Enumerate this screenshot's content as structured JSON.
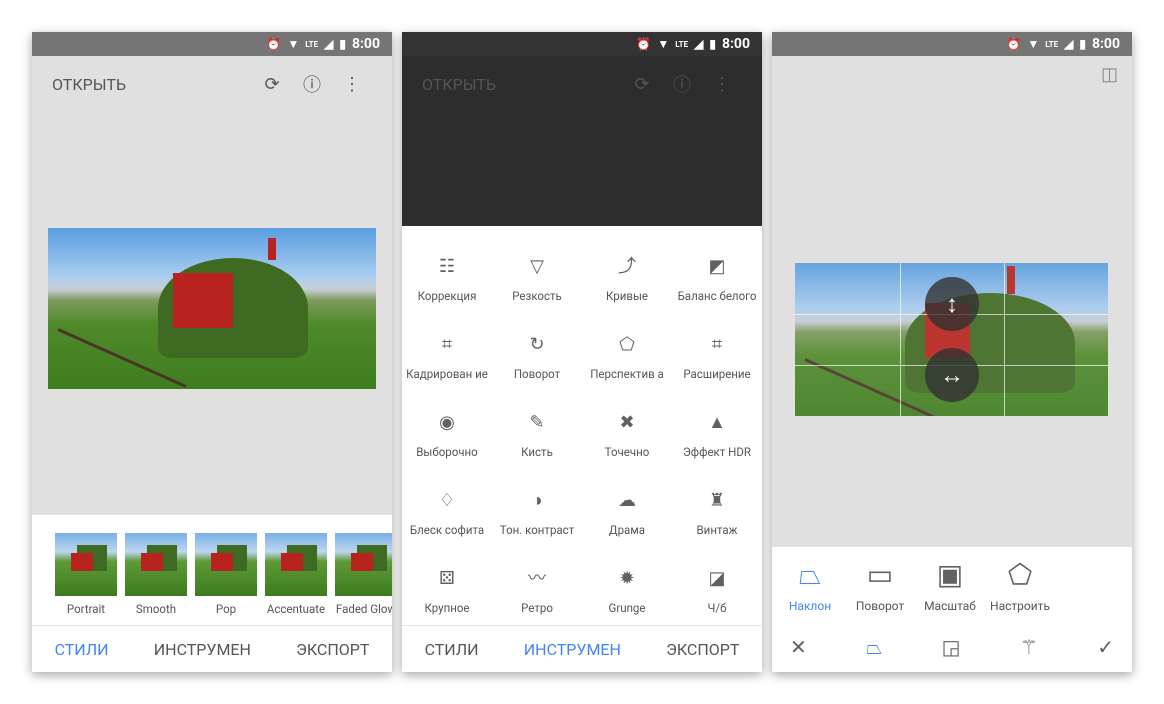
{
  "status": {
    "time": "8:00",
    "network": "LTE"
  },
  "panel1": {
    "header": {
      "open_label": "ОТКРЫТЬ"
    },
    "styles": [
      {
        "label": "Portrait"
      },
      {
        "label": "Smooth"
      },
      {
        "label": "Pop"
      },
      {
        "label": "Accentuate"
      },
      {
        "label": "Faded Glow"
      }
    ],
    "nav": {
      "styles": "СТИЛИ",
      "tools": "ИНСТРУМЕН",
      "export": "ЭКСПОРТ",
      "active": "styles"
    }
  },
  "panel2": {
    "header": {
      "open_label": "ОТКРЫТЬ"
    },
    "tools": [
      {
        "label": "Коррекция",
        "icon": "tune-icon",
        "glyph": "☷"
      },
      {
        "label": "Резкость",
        "icon": "triangle-icon",
        "glyph": "▽"
      },
      {
        "label": "Кривые",
        "icon": "curves-icon",
        "glyph": "⤴"
      },
      {
        "label": "Баланс белого",
        "icon": "white-balance-icon",
        "glyph": "◩"
      },
      {
        "label": "Кадрирован ие",
        "icon": "crop-icon",
        "glyph": "⌗"
      },
      {
        "label": "Поворот",
        "icon": "rotate-icon",
        "glyph": "↻"
      },
      {
        "label": "Перспектив а",
        "icon": "perspective-icon",
        "glyph": "⬠"
      },
      {
        "label": "Расширение",
        "icon": "expand-icon",
        "glyph": "⌗"
      },
      {
        "label": "Выборочно",
        "icon": "selective-icon",
        "glyph": "◉"
      },
      {
        "label": "Кисть",
        "icon": "brush-icon",
        "glyph": "✎"
      },
      {
        "label": "Точечно",
        "icon": "healing-icon",
        "glyph": "✖"
      },
      {
        "label": "Эффект HDR",
        "icon": "mountains-icon",
        "glyph": "▲"
      },
      {
        "label": "Блеск софита",
        "icon": "glamour-glow-icon",
        "glyph": "♢"
      },
      {
        "label": "Тон. контраст",
        "icon": "tonal-contrast-icon",
        "glyph": "◑"
      },
      {
        "label": "Драма",
        "icon": "cloud-icon",
        "glyph": "☁"
      },
      {
        "label": "Винтаж",
        "icon": "lamp-icon",
        "glyph": "♜"
      },
      {
        "label": "Крупное",
        "icon": "grain-icon",
        "glyph": "⚄"
      },
      {
        "label": "Ретро",
        "icon": "mustache-icon",
        "glyph": "〰"
      },
      {
        "label": "Grunge",
        "icon": "grunge-icon",
        "glyph": "✹"
      },
      {
        "label": "Ч/б",
        "icon": "black-white-icon",
        "glyph": "◪"
      }
    ],
    "nav": {
      "styles": "СТИЛИ",
      "tools": "ИНСТРУМЕН",
      "export": "ЭКСПОРТ",
      "active": "tools"
    }
  },
  "panel3": {
    "modes": [
      {
        "label": "Наклон",
        "icon": "tilt-icon",
        "glyph": "⏢",
        "active": true
      },
      {
        "label": "Поворот",
        "icon": "rotate-frame-icon",
        "glyph": "▭"
      },
      {
        "label": "Масштаб",
        "icon": "scale-icon",
        "glyph": "▣"
      },
      {
        "label": "Настроить",
        "icon": "free-perspective-icon",
        "glyph": "⬠"
      }
    ]
  },
  "colors": {
    "accent": "#4285f4",
    "dark_overlay": "#2d2d2d",
    "canvas": "#e0e0e0"
  }
}
